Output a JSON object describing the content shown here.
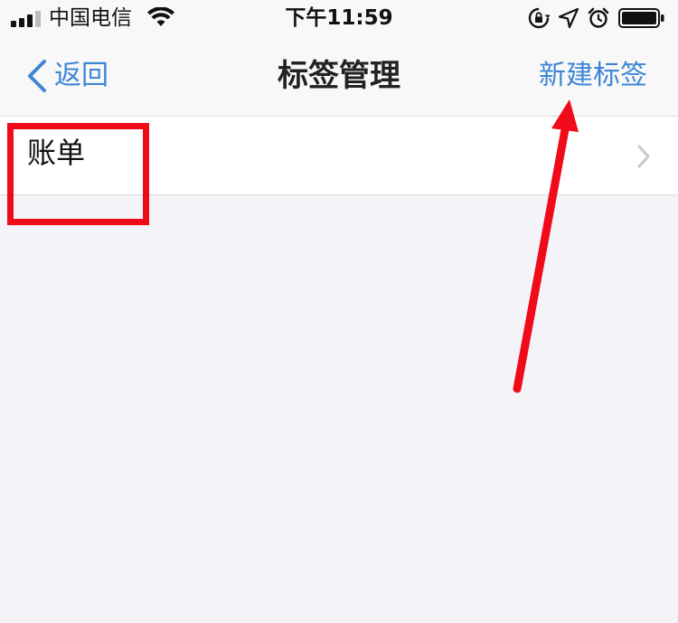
{
  "status_bar": {
    "carrier": "中国电信",
    "time": "下午11:59"
  },
  "nav": {
    "back_label": "返回",
    "title": "标签管理",
    "new_tag_label": "新建标签"
  },
  "list": {
    "items": [
      {
        "label": "账单"
      }
    ]
  },
  "icons": {
    "signal": "signal-bars-icon",
    "wifi": "wifi-icon",
    "orientation_lock": "rotation-lock-icon",
    "location": "location-arrow-icon",
    "alarm": "alarm-clock-icon",
    "battery": "battery-icon",
    "back": "chevron-left-icon",
    "disclosure": "chevron-right-icon"
  },
  "colors": {
    "accent": "#3d86d6",
    "annotation": "#f00b1b",
    "background": "#f4f3f8"
  }
}
